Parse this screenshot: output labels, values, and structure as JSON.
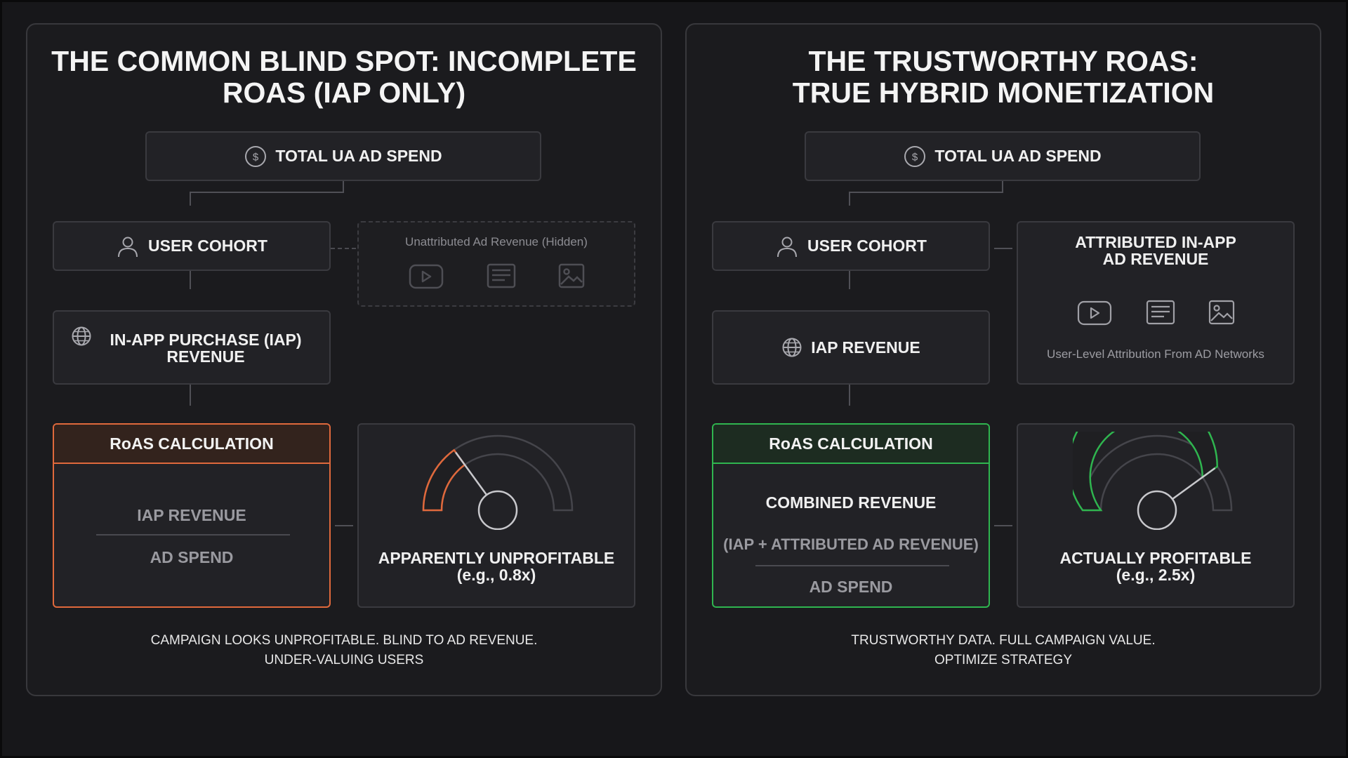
{
  "left": {
    "title": [
      "THE COMMON BLIND SPOT: INCOMPLETE",
      "ROAS (IAP ONLY)"
    ],
    "spend_label": "TOTAL UA AD SPEND",
    "cohort_label": "USER COHORT",
    "hidden_label": "Unattributed Ad Revenue (Hidden)",
    "iap_label": [
      "IN-APP PURCHASE (IAP)",
      "REVENUE"
    ],
    "calc_header": "RoAS CALCULATION",
    "numerator": "IAP REVENUE",
    "denominator": "AD SPEND",
    "result": [
      "APPARENTLY UNPROFITABLE",
      "(e.g., 0.8x)"
    ],
    "caption": [
      "CAMPAIGN LOOKS UNPROFITABLE. BLIND TO AD REVENUE.",
      "UNDER-VALUING USERS"
    ],
    "accent": "#e0693c",
    "gauge_level": 0.3
  },
  "right": {
    "title": [
      "THE TRUSTWORTHY ROAS:",
      "TRUE HYBRID MONETIZATION"
    ],
    "spend_label": "TOTAL UA AD SPEND",
    "cohort_label": "USER COHORT",
    "attributed_title": [
      "ATTRIBUTED IN-APP",
      "AD REVENUE"
    ],
    "attribution_note": "User-Level Attribution From AD Networks",
    "iap_label": "IAP REVENUE",
    "calc_header": "RoAS CALCULATION",
    "numerator": "COMBINED REVENUE",
    "numerator_detail": "(IAP + ATTRIBUTED AD REVENUE)",
    "denominator": "AD SPEND",
    "result": [
      "ACTUALLY PROFITABLE",
      "(e.g., 2.5x)"
    ],
    "caption": [
      "TRUSTWORTHY DATA. FULL CAMPAIGN VALUE.",
      "OPTIMIZE STRATEGY"
    ],
    "accent": "#2fb54f",
    "gauge_level": 0.8
  },
  "icons": [
    "dollar-icon",
    "user-icon",
    "globe-icon",
    "video-play-icon",
    "article-icon",
    "image-icon"
  ]
}
